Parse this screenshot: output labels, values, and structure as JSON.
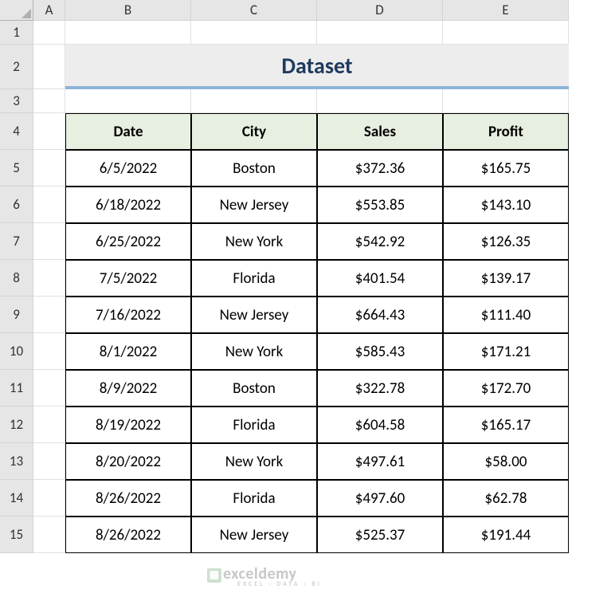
{
  "columns": [
    "",
    "A",
    "B",
    "C",
    "D",
    "E"
  ],
  "row_numbers": [
    "1",
    "2",
    "3",
    "4",
    "5",
    "6",
    "7",
    "8",
    "9",
    "10",
    "11",
    "12",
    "13",
    "14",
    "15"
  ],
  "title": "Dataset",
  "headers": {
    "date": "Date",
    "city": "City",
    "sales": "Sales",
    "profit": "Profit"
  },
  "chart_data": {
    "type": "table",
    "columns": [
      "Date",
      "City",
      "Sales",
      "Profit"
    ],
    "rows": [
      {
        "date": "6/5/2022",
        "city": "Boston",
        "sales": "$372.36",
        "profit": "$165.75"
      },
      {
        "date": "6/18/2022",
        "city": "New Jersey",
        "sales": "$553.85",
        "profit": "$143.10"
      },
      {
        "date": "6/25/2022",
        "city": "New York",
        "sales": "$542.92",
        "profit": "$126.35"
      },
      {
        "date": "7/5/2022",
        "city": "Florida",
        "sales": "$401.54",
        "profit": "$139.17"
      },
      {
        "date": "7/16/2022",
        "city": "New Jersey",
        "sales": "$664.43",
        "profit": "$111.40"
      },
      {
        "date": "8/1/2022",
        "city": "New York",
        "sales": "$585.43",
        "profit": "$171.21"
      },
      {
        "date": "8/9/2022",
        "city": "Boston",
        "sales": "$322.78",
        "profit": "$172.70"
      },
      {
        "date": "8/19/2022",
        "city": "Florida",
        "sales": "$604.58",
        "profit": "$165.17"
      },
      {
        "date": "8/20/2022",
        "city": "New York",
        "sales": "$497.61",
        "profit": "$58.00"
      },
      {
        "date": "8/26/2022",
        "city": "Florida",
        "sales": "$497.60",
        "profit": "$62.78"
      },
      {
        "date": "8/26/2022",
        "city": "New Jersey",
        "sales": "$525.37",
        "profit": "$191.44"
      }
    ]
  },
  "watermark": {
    "brand": "exceldemy",
    "tagline": "EXCEL · DATA · BI"
  }
}
